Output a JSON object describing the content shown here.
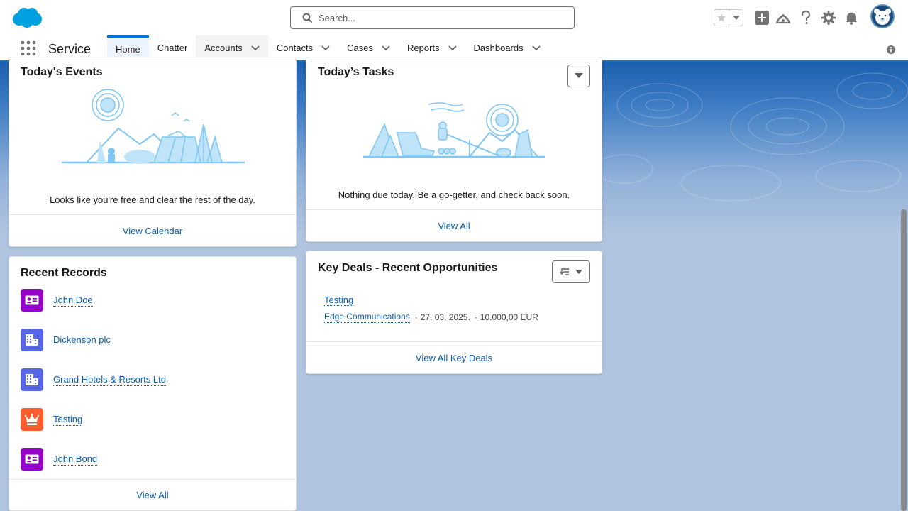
{
  "header": {
    "search_placeholder": "Search...",
    "icons": [
      "salesforce-cloud-logo",
      "favorites-star-icon",
      "add-icon",
      "trailhead-icon",
      "help-icon",
      "setup-gear-icon",
      "notifications-bell-icon",
      "user-avatar"
    ]
  },
  "nav": {
    "app_name": "Service",
    "items": [
      {
        "label": "Home",
        "active": true,
        "has_menu": false
      },
      {
        "label": "Chatter",
        "active": false,
        "has_menu": false
      },
      {
        "label": "Accounts",
        "active": false,
        "has_menu": true
      },
      {
        "label": "Contacts",
        "active": false,
        "has_menu": true
      },
      {
        "label": "Cases",
        "active": false,
        "has_menu": true
      },
      {
        "label": "Reports",
        "active": false,
        "has_menu": true
      },
      {
        "label": "Dashboards",
        "active": false,
        "has_menu": true
      }
    ]
  },
  "events": {
    "title": "Today's Events",
    "message": "Looks like you're free and clear the rest of the day.",
    "footer_link": "View Calendar"
  },
  "tasks": {
    "title": "Today’s Tasks",
    "message": "Nothing due today. Be a go-getter, and check back soon.",
    "footer_link": "View All"
  },
  "recent_records": {
    "title": "Recent Records",
    "items": [
      {
        "name": "John Doe",
        "type": "contact",
        "color": "#9602c7"
      },
      {
        "name": "Dickenson plc",
        "type": "account",
        "color": "#5867e8"
      },
      {
        "name": "Grand Hotels & Resorts Ltd",
        "type": "account",
        "color": "#5867e8"
      },
      {
        "name": "Testing",
        "type": "opportunity",
        "color": "#ff5d2d"
      },
      {
        "name": "John Bond",
        "type": "contact",
        "color": "#9602c7"
      }
    ],
    "footer_link": "View All"
  },
  "key_deals": {
    "title": "Key Deals - Recent Opportunities",
    "deal_name": "Testing",
    "account": "Edge Communications",
    "close_date": "27. 03. 2025.",
    "amount": "10.000,00 EUR",
    "separator": "·",
    "footer_link": "View All Key Deals"
  },
  "colors": {
    "brand_blue": "#0176d3",
    "link": "#0b5cab",
    "illustration": "#7fc6f2"
  }
}
